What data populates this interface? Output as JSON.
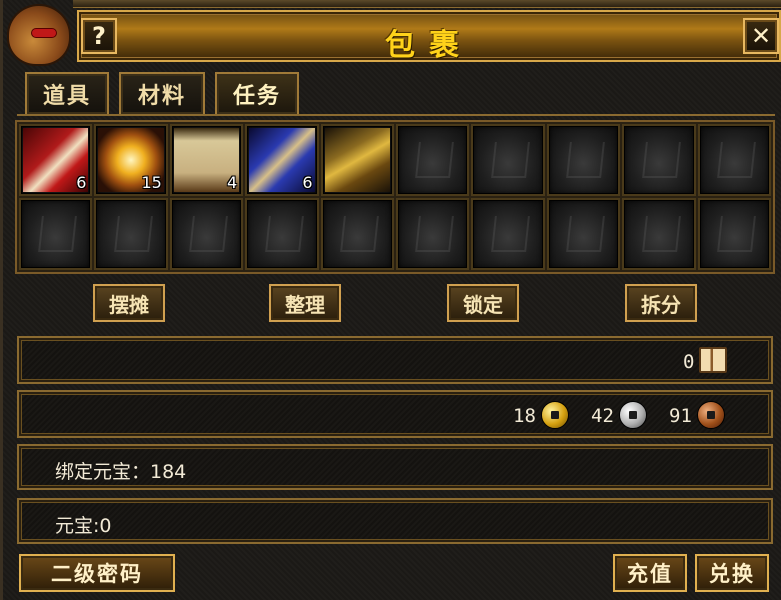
{
  "window": {
    "title": "包裹",
    "help_label": "?",
    "close_label": "✕"
  },
  "tabs": [
    {
      "label": "道具",
      "active": false
    },
    {
      "label": "材料",
      "active": false
    },
    {
      "label": "任务",
      "active": true
    }
  ],
  "inventory": {
    "slots": [
      {
        "item": "red-scroll",
        "qty": "6"
      },
      {
        "item": "golden-medal",
        "qty": "15"
      },
      {
        "item": "map-scroll",
        "qty": "4"
      },
      {
        "item": "blue-coffin",
        "qty": "6"
      },
      {
        "item": "book-axe",
        "qty": ""
      },
      {
        "item": "",
        "qty": ""
      },
      {
        "item": "",
        "qty": ""
      },
      {
        "item": "",
        "qty": ""
      },
      {
        "item": "",
        "qty": ""
      },
      {
        "item": "",
        "qty": ""
      },
      {
        "item": "",
        "qty": ""
      },
      {
        "item": "",
        "qty": ""
      },
      {
        "item": "",
        "qty": ""
      },
      {
        "item": "",
        "qty": ""
      },
      {
        "item": "",
        "qty": ""
      },
      {
        "item": "",
        "qty": ""
      },
      {
        "item": "",
        "qty": ""
      },
      {
        "item": "",
        "qty": ""
      },
      {
        "item": "",
        "qty": ""
      },
      {
        "item": "",
        "qty": ""
      }
    ]
  },
  "actions": {
    "stall": "摆摊",
    "sort": "整理",
    "lock": "锁定",
    "split": "拆分"
  },
  "currency": {
    "book_count": "0",
    "gold": "18",
    "silver": "42",
    "copper": "91"
  },
  "yuanbao": {
    "bound_label": "绑定元宝：184",
    "plain_label": "元宝:0"
  },
  "bottom": {
    "password": "二级密码",
    "charge": "充值",
    "exchange": "兑换"
  }
}
